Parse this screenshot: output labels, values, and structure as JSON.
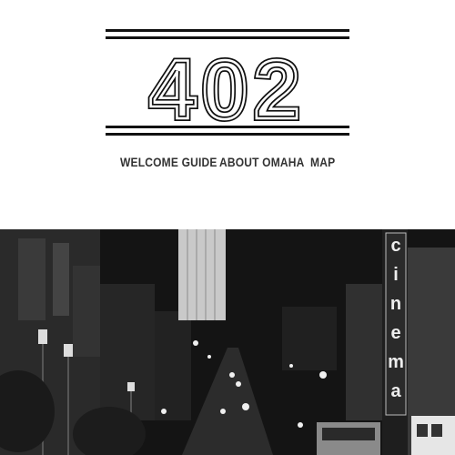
{
  "logo": {
    "text": "402"
  },
  "nav": {
    "items": [
      {
        "label": "WELCOME GUIDE"
      },
      {
        "label": "ABOUT OMAHA"
      },
      {
        "label": "MAP"
      }
    ]
  },
  "hero": {
    "sign_letters": [
      "c",
      "i",
      "n",
      "e",
      "m",
      "a"
    ]
  },
  "colors": {
    "text": "#333333",
    "logo": "#111111",
    "hero_bg": "#111111"
  }
}
